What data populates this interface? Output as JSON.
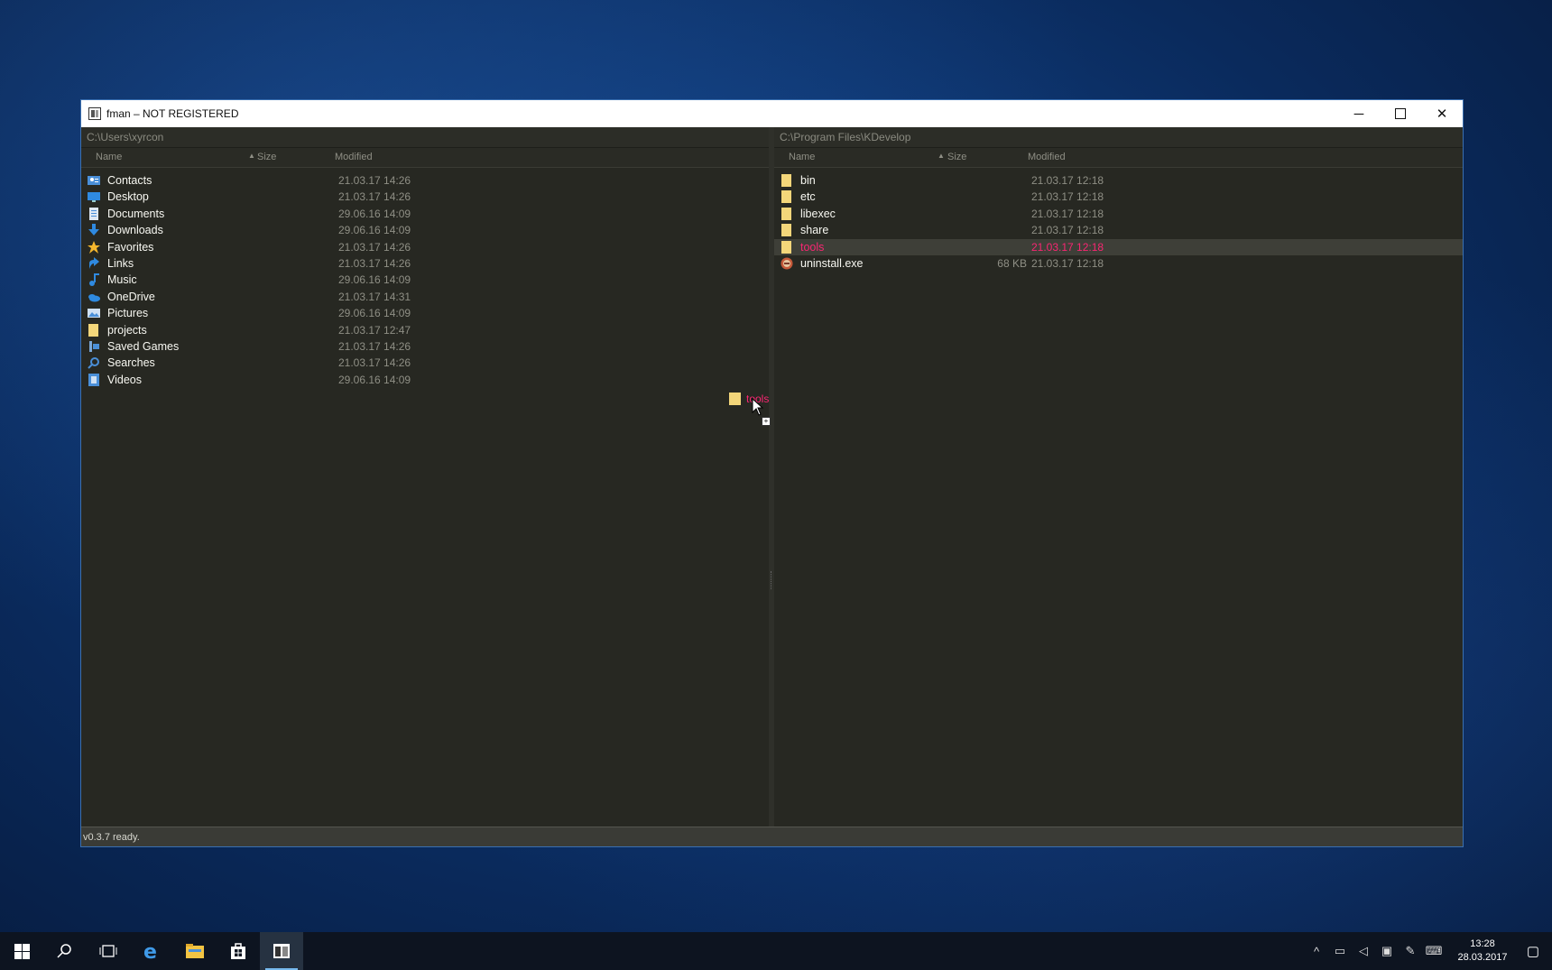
{
  "window": {
    "title": "fman – NOT REGISTERED",
    "minimize_label": "─",
    "close_label": "✕"
  },
  "left_pane": {
    "path": "C:\\Users\\xyrcon",
    "columns": {
      "name": "Name",
      "size": "Size",
      "modified": "Modified",
      "sort_indicator": "▲"
    },
    "rows": [
      {
        "name": "Contacts",
        "size": "",
        "modified": "21.03.17 14:26",
        "icon": "contacts-icon"
      },
      {
        "name": "Desktop",
        "size": "",
        "modified": "21.03.17 14:26",
        "icon": "desktop-icon"
      },
      {
        "name": "Documents",
        "size": "",
        "modified": "29.06.16 14:09",
        "icon": "documents-icon"
      },
      {
        "name": "Downloads",
        "size": "",
        "modified": "29.06.16 14:09",
        "icon": "downloads-icon"
      },
      {
        "name": "Favorites",
        "size": "",
        "modified": "21.03.17 14:26",
        "icon": "favorites-icon"
      },
      {
        "name": "Links",
        "size": "",
        "modified": "21.03.17 14:26",
        "icon": "links-icon"
      },
      {
        "name": "Music",
        "size": "",
        "modified": "29.06.16 14:09",
        "icon": "music-icon"
      },
      {
        "name": "OneDrive",
        "size": "",
        "modified": "21.03.17 14:31",
        "icon": "onedrive-icon"
      },
      {
        "name": "Pictures",
        "size": "",
        "modified": "29.06.16 14:09",
        "icon": "pictures-icon"
      },
      {
        "name": "projects",
        "size": "",
        "modified": "21.03.17 12:47",
        "icon": "folder-icon"
      },
      {
        "name": "Saved Games",
        "size": "",
        "modified": "21.03.17 14:26",
        "icon": "saved-games-icon"
      },
      {
        "name": "Searches",
        "size": "",
        "modified": "21.03.17 14:26",
        "icon": "searches-icon"
      },
      {
        "name": "Videos",
        "size": "",
        "modified": "29.06.16 14:09",
        "icon": "videos-icon"
      }
    ]
  },
  "right_pane": {
    "path": "C:\\Program Files\\KDevelop",
    "columns": {
      "name": "Name",
      "size": "Size",
      "modified": "Modified",
      "sort_indicator": "▲"
    },
    "rows": [
      {
        "name": "bin",
        "size": "",
        "modified": "21.03.17 12:18",
        "icon": "folder-icon"
      },
      {
        "name": "etc",
        "size": "",
        "modified": "21.03.17 12:18",
        "icon": "folder-icon"
      },
      {
        "name": "libexec",
        "size": "",
        "modified": "21.03.17 12:18",
        "icon": "folder-icon"
      },
      {
        "name": "share",
        "size": "",
        "modified": "21.03.17 12:18",
        "icon": "folder-icon"
      },
      {
        "name": "tools",
        "size": "",
        "modified": "21.03.17 12:18",
        "icon": "folder-icon",
        "selected": true
      },
      {
        "name": "uninstall.exe",
        "size": "68 KB",
        "modified": "21.03.17 12:18",
        "icon": "exe-icon"
      }
    ]
  },
  "drag": {
    "label": "tools",
    "plus": "+"
  },
  "status": {
    "text": "v0.3.7 ready."
  },
  "taskbar": {
    "clock_time": "13:28",
    "clock_date": "28.03.2017"
  },
  "colors": {
    "background": "#272822",
    "text": "#f8f8f2",
    "muted": "#8f8f85",
    "selected_text": "#f92672",
    "folder": "#f3d67a",
    "accent": "#76b9ed"
  }
}
